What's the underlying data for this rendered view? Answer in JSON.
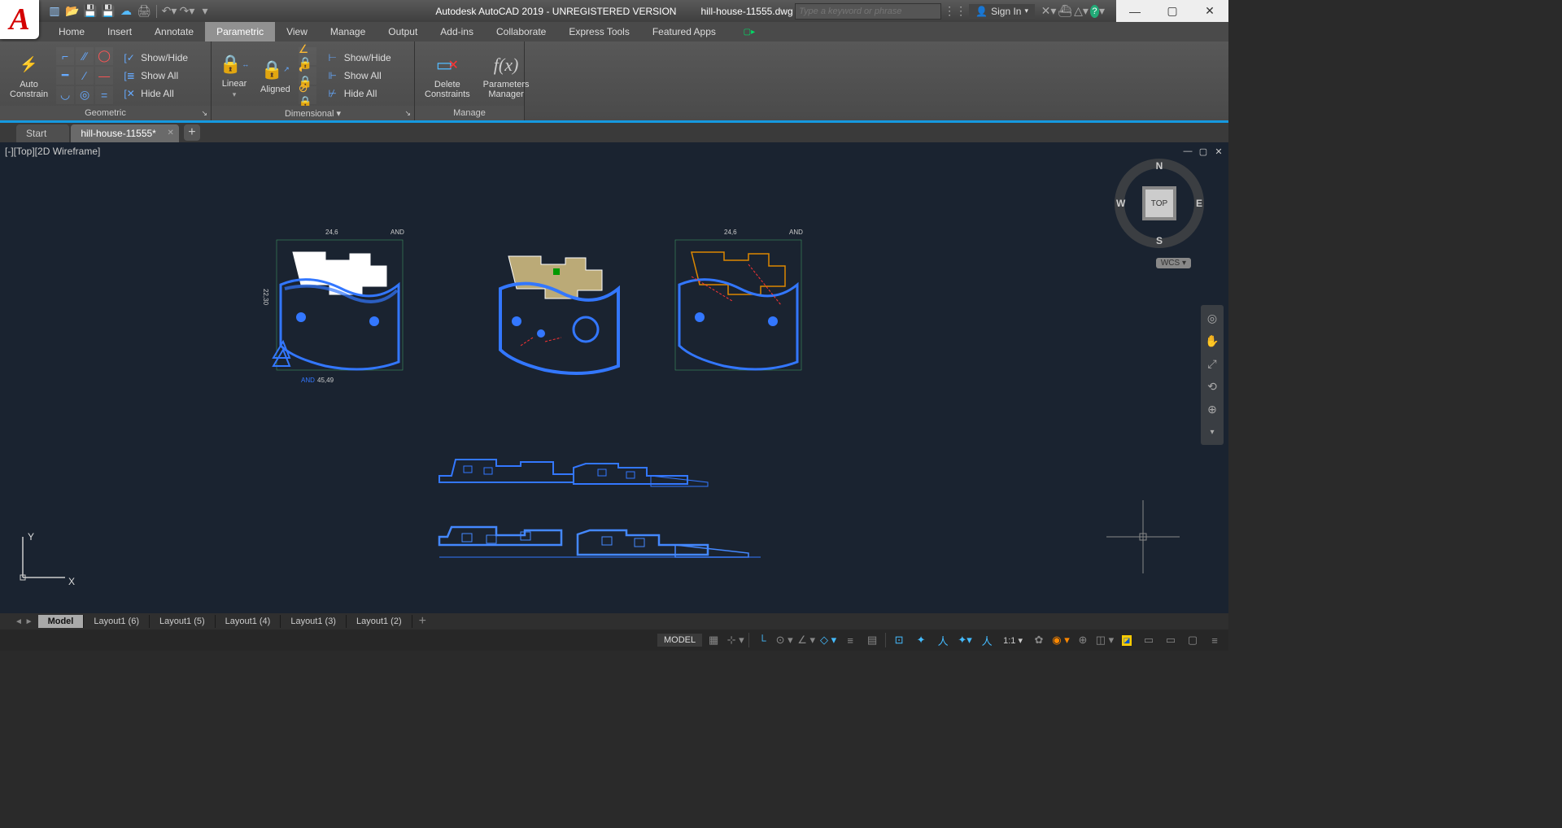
{
  "title": {
    "app": "Autodesk AutoCAD 2019 - UNREGISTERED VERSION",
    "file": "hill-house-11555.dwg"
  },
  "search": {
    "placeholder": "Type a keyword or phrase"
  },
  "signin": "Sign In",
  "menutabs": [
    "Home",
    "Insert",
    "Annotate",
    "Parametric",
    "View",
    "Manage",
    "Output",
    "Add-ins",
    "Collaborate",
    "Express Tools",
    "Featured Apps"
  ],
  "menutab_active": "Parametric",
  "ribbon": {
    "geometric": {
      "label": "Geometric",
      "auto": "Auto\nConstrain",
      "show_hide": "Show/Hide",
      "show_all": "Show All",
      "hide_all": "Hide All"
    },
    "dimensional": {
      "label": "Dimensional ▾",
      "linear": "Linear",
      "aligned": "Aligned",
      "show_hide": "Show/Hide",
      "show_all": "Show All",
      "hide_all": "Hide All"
    },
    "manage": {
      "label": "Manage",
      "delete": "Delete\nConstraints",
      "params": "Parameters\nManager"
    }
  },
  "filetabs": {
    "start": "Start",
    "file": "hill-house-11555*"
  },
  "viewport": {
    "label": "[-][Top][2D Wireframe]"
  },
  "viewcube": {
    "top": "TOP",
    "n": "N",
    "s": "S",
    "e": "E",
    "w": "W",
    "wcs": "WCS ▾"
  },
  "dims": {
    "top": "24,6",
    "right": "22,30",
    "bottom": "45,49",
    "and": "AND"
  },
  "layouttabs": [
    "Model",
    "Layout1 (6)",
    "Layout1 (5)",
    "Layout1 (4)",
    "Layout1 (3)",
    "Layout1 (2)"
  ],
  "status": {
    "model": "MODEL",
    "scale": "1:1"
  },
  "ucs": {
    "x": "X",
    "y": "Y"
  },
  "cart": "▾"
}
